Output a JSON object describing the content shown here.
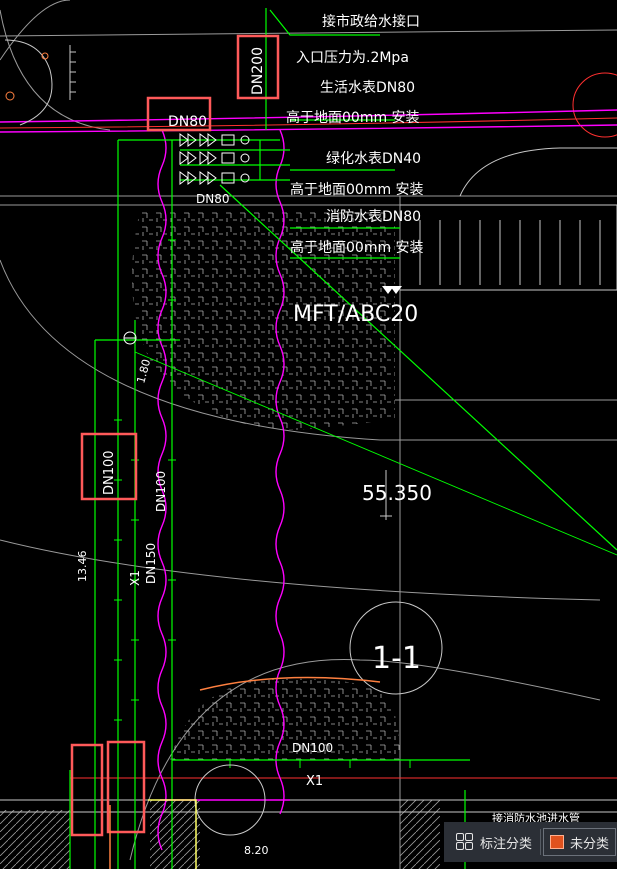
{
  "labels": {
    "municipal_connection": "接市政给水接口",
    "inlet_pressure": "入口压力为.2Mpa",
    "domestic_meter": "生活水表DN80",
    "install_note_1": "高于地面00mm  安装",
    "greening_meter": "绿化水表DN40",
    "install_note_2": "高于地面00mm  安装",
    "fire_meter": "消防水表DN80",
    "install_note_3": "高于地面00mm  安装",
    "building": "MFT/ABC20",
    "elevation": "55.350",
    "section": "1-1",
    "dn200": "DN200",
    "dn80_boxed": "DN80",
    "dn80_lower": "DN80",
    "dn100_boxed": "DN100",
    "dn100_vertical": "DN100",
    "dn150": "DN150",
    "dn100_bottom": "DN100",
    "x1_vertical": "X1",
    "x1_bottom": "X1",
    "dim_180": "1.80",
    "dim_1346": "13.46",
    "dim_820": "8.20",
    "bottom_note": "接消防水池进水管"
  },
  "panel": {
    "classify_label": "标注分类",
    "unclassified_label": "未分类",
    "unclassified_color": "#e0521e"
  },
  "colors": {
    "background": "#000000",
    "pipe_green": "#00ff00",
    "boundary_magenta": "#ff00ff",
    "highlight_red": "#ff5a5a",
    "grid_white": "#c8c8c8"
  }
}
